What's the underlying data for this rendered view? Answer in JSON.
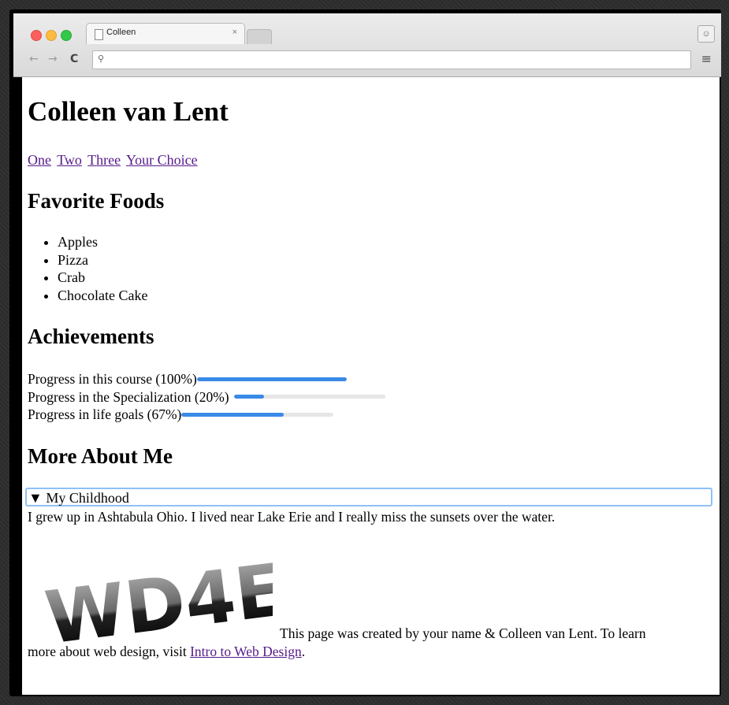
{
  "browser": {
    "tab_title": "Colleen",
    "tab_close": "×",
    "nav_back": "←",
    "nav_forward": "→",
    "nav_reload": "C",
    "omnibox_icon": "search-icon",
    "omnibox_value": "",
    "menu_icon": "hamburger-menu-icon",
    "profile_icon": "person-icon"
  },
  "page": {
    "title": "Colleen van Lent",
    "nav_links": [
      "One",
      "Two",
      "Three",
      "Your Choice"
    ],
    "foods_heading": "Favorite Foods",
    "foods": [
      "Apples",
      "Pizza",
      "Crab",
      "Chocolate Cake"
    ],
    "achievements_heading": "Achievements",
    "progress": [
      {
        "label": "Progress in this course (100%)",
        "value": 1.0
      },
      {
        "label": "Progress in the Specialization (20%)",
        "value": 0.2
      },
      {
        "label": "Progress in life goals (67%)",
        "value": 0.67
      }
    ],
    "more_heading": "More About Me",
    "details_summary": "▼ My Childhood",
    "details_text": "I grew up in Ashtabula Ohio. I lived near Lake Erie and I really miss the sunsets over the water.",
    "logo_text": "WD4E",
    "footer_line1": "This page was created by your name & Colleen van Lent. To learn",
    "footer_line2_prefix": "more about web design, visit ",
    "footer_link": "Intro to Web Design",
    "footer_suffix": "."
  },
  "colors": {
    "progress_fill": "#3a8ae8",
    "progress_track": "#e6e6e6",
    "link_visited": "#551a8b",
    "details_focus_border": "#8ec0f7"
  }
}
